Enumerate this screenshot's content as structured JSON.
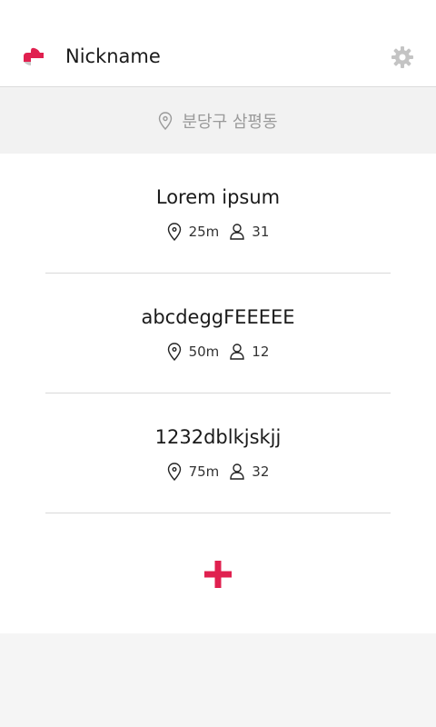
{
  "header": {
    "title": "Nickname",
    "logo_icon": "heart-logo-icon",
    "settings_icon": "gear-icon",
    "accent_color": "#e0204f"
  },
  "location_bar": {
    "icon": "location-pin-icon",
    "text": "분당구 삼평동"
  },
  "rooms": [
    {
      "name": "Lorem ipsum",
      "distance": "25m",
      "members": "31"
    },
    {
      "name": "abcdeggFEEEEE",
      "distance": "50m",
      "members": "12"
    },
    {
      "name": "1232dblkjskjj",
      "distance": "75m",
      "members": "32"
    }
  ],
  "add_button": {
    "icon": "plus-icon"
  }
}
